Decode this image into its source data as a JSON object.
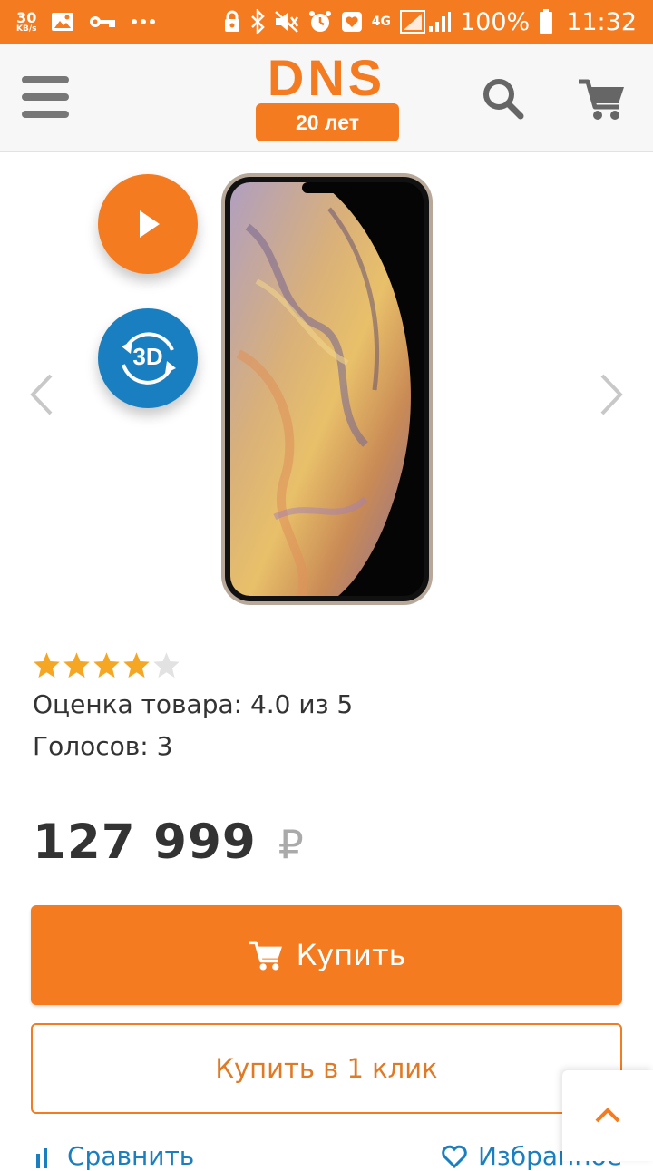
{
  "status_bar": {
    "speed_value": "30",
    "speed_unit": "KB/s",
    "network": "4G",
    "battery": "100%",
    "time": "11:32",
    "icons": [
      "image-icon",
      "key-icon",
      "more-icon",
      "vpn-icon",
      "bluetooth-icon",
      "mute-icon",
      "alarm-icon",
      "heart-icon",
      "signal-icon",
      "battery-icon"
    ]
  },
  "header": {
    "logo_text": "DNS",
    "logo_badge": "20 лет",
    "icons": [
      "menu-icon",
      "search-icon",
      "cart-icon"
    ]
  },
  "gallery": {
    "video_button": "play-icon",
    "three_d_label": "3D",
    "prev": "chevron-left-icon",
    "next": "chevron-right-icon"
  },
  "rating": {
    "stars_filled": 4,
    "stars_total": 5,
    "text": "Оценка товара: 4.0 из 5",
    "votes": "Голосов: 3",
    "star_color": "#f5a623"
  },
  "price": {
    "amount": "127 999",
    "currency": "₽"
  },
  "actions": {
    "buy_label": "Купить",
    "one_click_label": "Купить в 1 клик",
    "compare_label": "Сравнить",
    "favorite_label": "Избранное"
  },
  "colors": {
    "accent": "#f47b20",
    "link": "#1a7fc1"
  }
}
